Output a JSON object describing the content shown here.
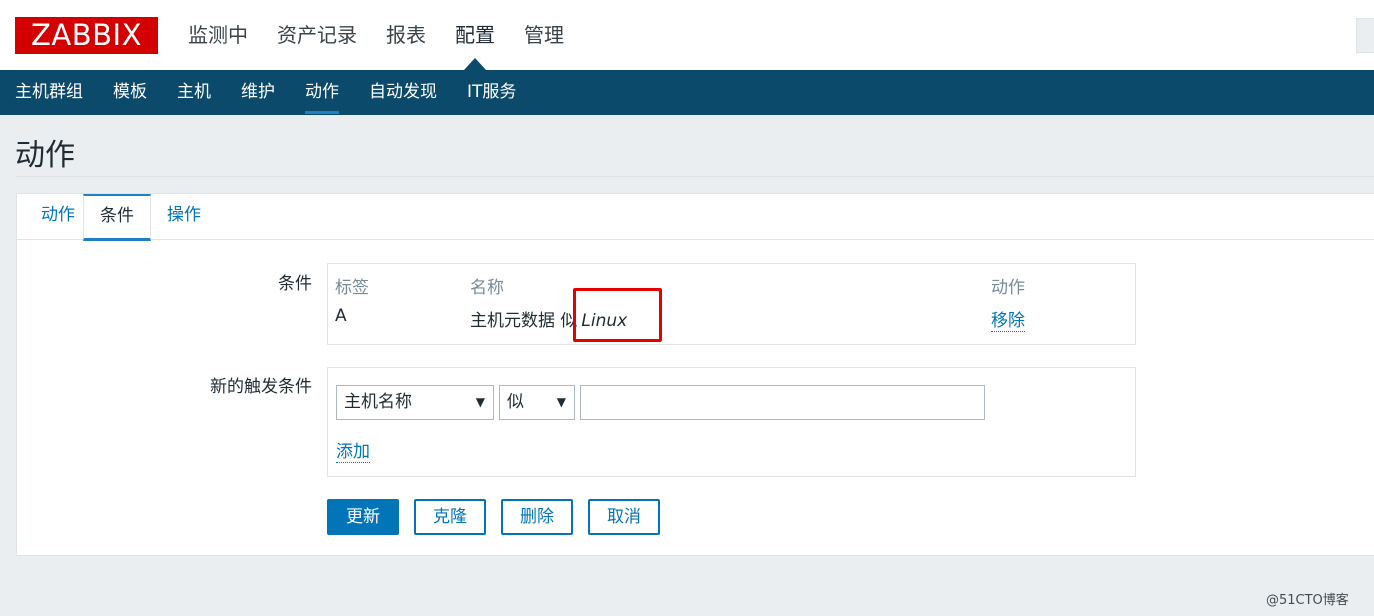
{
  "logo": {
    "text": "ZABBIX",
    "color": "#d40000"
  },
  "main_menu": [
    "监测中",
    "资产记录",
    "报表",
    "配置",
    "管理"
  ],
  "main_menu_active": "配置",
  "sub_menu": [
    "主机群组",
    "模板",
    "主机",
    "维护",
    "动作",
    "自动发现",
    "IT服务"
  ],
  "sub_menu_active": "动作",
  "page": {
    "title": "动作"
  },
  "tabs": [
    "动作",
    "条件",
    "操作"
  ],
  "tab_active": "条件",
  "conditions": {
    "label": "条件",
    "headers": {
      "label": "标签",
      "name": "名称",
      "action": "动作"
    },
    "rows": [
      {
        "label": "A",
        "name_text": "主机元数据 似",
        "name_value": "Linux",
        "action": "移除"
      }
    ]
  },
  "new_condition": {
    "label": "新的触发条件",
    "type_selected": "主机名称",
    "operator_selected": "似",
    "value": "",
    "add_label": "添加"
  },
  "buttons": {
    "update": "更新",
    "clone": "克隆",
    "delete": "删除",
    "cancel": "取消"
  },
  "watermark": "@51CTO博客",
  "colors": {
    "nav": "#0b4a6a",
    "link": "#0275b8",
    "highlight": "#e60000"
  }
}
